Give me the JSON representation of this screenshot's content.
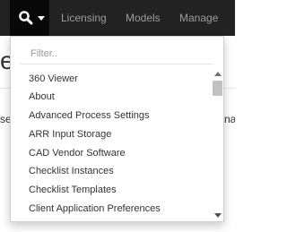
{
  "navbar": {
    "items": [
      "Licensing",
      "Models",
      "Manage"
    ]
  },
  "search_menu": {
    "icon": "search-icon",
    "filter_placeholder": "Filter..",
    "filter_value": "",
    "items": [
      "360 Viewer",
      "About",
      "Advanced Process Settings",
      "ARR Input Storage",
      "CAD Vendor Software",
      "Checklist Instances",
      "Checklist Templates",
      "Client Application Preferences"
    ]
  },
  "background_page": {
    "heading_fragment": "el",
    "body_fragment_left": "se",
    "body_fragment_right": "na"
  }
}
